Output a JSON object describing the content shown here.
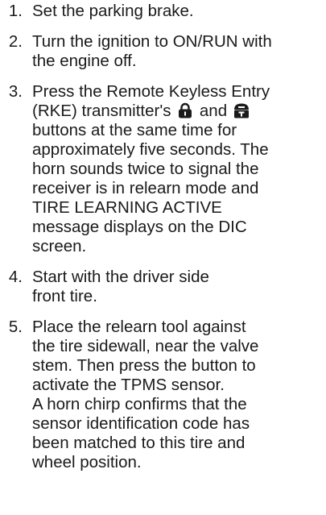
{
  "steps": [
    {
      "number": "1.",
      "lines": [
        "Set the parking brake."
      ]
    },
    {
      "number": "2.",
      "lines": [
        "Turn the ignition to ON/RUN with",
        "the engine off."
      ]
    },
    {
      "number": "3.",
      "line1": "Press the Remote Keyless Entry",
      "line2_before": "(RKE) transmitter's",
      "line2_between": "and",
      "icons": [
        "lock-icon",
        "unlock-icon"
      ],
      "lines_after": [
        "buttons at the same time for",
        "approximately five seconds. The",
        "horn sounds twice to signal the",
        "receiver is in relearn mode and",
        "TIRE LEARNING ACTIVE",
        "message displays on the DIC",
        "screen."
      ]
    },
    {
      "number": "4.",
      "lines": [
        "Start with the driver side",
        "front tire."
      ]
    },
    {
      "number": "5.",
      "lines": [
        "Place the relearn tool against",
        "the tire sidewall, near the valve",
        "stem. Then press the button to",
        "activate the TPMS sensor.",
        "A horn chirp confirms that the",
        "sensor identification code has",
        "been matched to this tire and",
        "wheel position."
      ]
    }
  ]
}
